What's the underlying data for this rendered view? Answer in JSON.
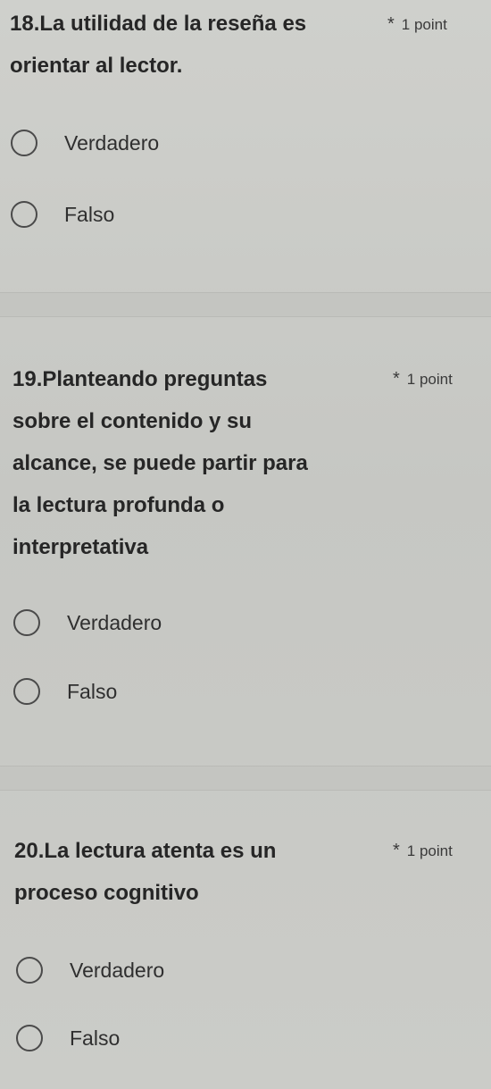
{
  "questions": [
    {
      "title": "18.La utilidad de la reseña es\norientar al lector.",
      "points": "1 point",
      "options": [
        "Verdadero",
        "Falso"
      ]
    },
    {
      "title": "19.Planteando preguntas\nsobre el contenido y su\nalcance, se puede partir para\nla lectura profunda o\ninterpretativa",
      "points": "1 point",
      "options": [
        "Verdadero",
        "Falso"
      ]
    },
    {
      "title": "20.La lectura atenta es un\nproceso cognitivo",
      "points": "1 point",
      "options": [
        "Verdadero",
        "Falso"
      ]
    }
  ],
  "colors": {
    "background": "#c9cac6",
    "text": "#262626",
    "radio_border": "#4a4a4a"
  },
  "icons": {
    "required": "asterisk-icon",
    "radio": "radio-unchecked-icon"
  }
}
